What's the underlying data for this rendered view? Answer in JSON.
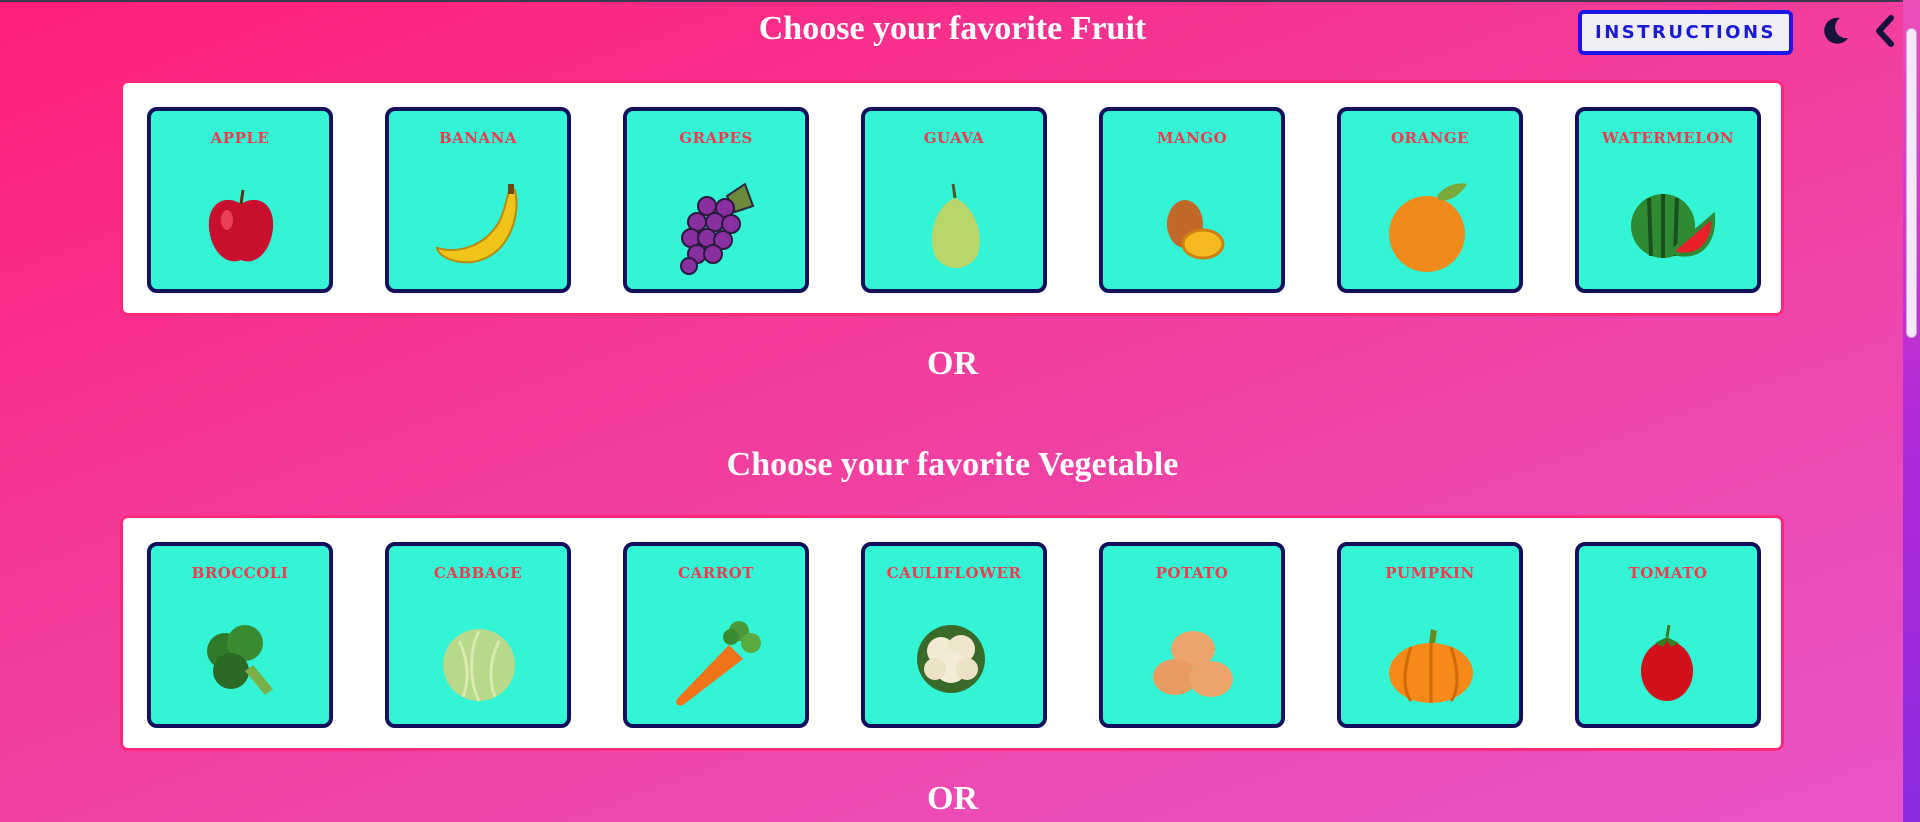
{
  "header": {
    "instructions_label": "INSTRUCTIONS",
    "theme_icon": "moon-icon",
    "back_icon": "chevron-left-icon"
  },
  "fruits": {
    "title": "Choose your favorite Fruit",
    "items": [
      {
        "label": "APPLE",
        "icon": "apple-icon"
      },
      {
        "label": "BANANA",
        "icon": "banana-icon"
      },
      {
        "label": "GRAPES",
        "icon": "grapes-icon"
      },
      {
        "label": "GUAVA",
        "icon": "guava-icon"
      },
      {
        "label": "MANGO",
        "icon": "mango-icon"
      },
      {
        "label": "ORANGE",
        "icon": "orange-icon"
      },
      {
        "label": "WATERMELON",
        "icon": "watermelon-icon"
      }
    ]
  },
  "separator_1": "OR",
  "vegetables": {
    "title": "Choose your favorite Vegetable",
    "items": [
      {
        "label": "BROCCOLI",
        "icon": "broccoli-icon"
      },
      {
        "label": "CABBAGE",
        "icon": "cabbage-icon"
      },
      {
        "label": "CARROT",
        "icon": "carrot-icon"
      },
      {
        "label": "CAULIFLOWER",
        "icon": "cauliflower-icon"
      },
      {
        "label": "POTATO",
        "icon": "potato-icon"
      },
      {
        "label": "PUMPKIN",
        "icon": "pumpkin-icon"
      },
      {
        "label": "TOMATO",
        "icon": "tomato-icon"
      }
    ]
  },
  "separator_2": "OR",
  "colors": {
    "card_bg": "#33f5d5",
    "card_border": "#12105a",
    "label_color": "#ef3b4f",
    "button_border": "#1b15e6"
  }
}
